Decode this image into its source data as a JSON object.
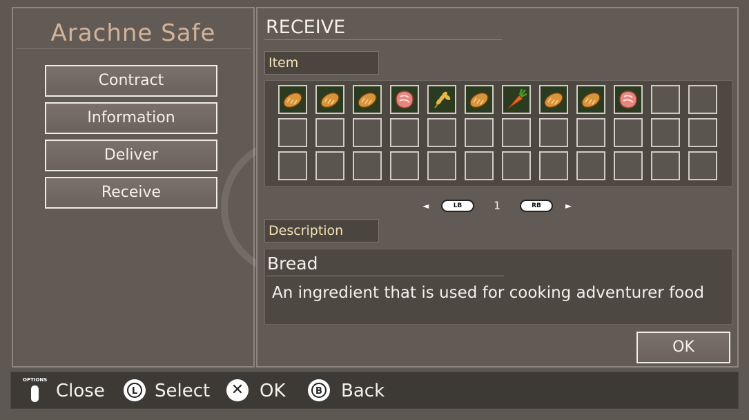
{
  "left_panel": {
    "title": "Arachne Safe",
    "menu": {
      "contract": "Contract",
      "information": "Information",
      "deliver": "Deliver",
      "receive": "Receive"
    }
  },
  "right_panel": {
    "title": "RECEIVE",
    "item_label": "Item",
    "grid": {
      "rows": 3,
      "cols": 12,
      "items": [
        "bread",
        "bread",
        "bread",
        "raw-meat",
        "wheat",
        "bread",
        "carrot",
        "bread",
        "bread",
        "raw-meat"
      ]
    },
    "pager": {
      "prev_arrow": "◄",
      "prev_button": "LB",
      "page": "1",
      "next_button": "RB",
      "next_arrow": "►"
    },
    "description_label": "Description",
    "description": {
      "name": "Bread",
      "text": "An ingredient that is used for cooking adventurer food"
    },
    "ok_label": "OK"
  },
  "bottom_bar": {
    "options_label": "OPTIONS",
    "close": "Close",
    "select_button": "L",
    "select": "Select",
    "ok_button": "✕",
    "ok": "OK",
    "back_button": "B",
    "back": "Back"
  },
  "colors": {
    "background": "#5e5853",
    "panel": "#625b55",
    "label_text": "#f3e2b2",
    "title_text": "#d2b39a",
    "bread": "#d9943a",
    "meat": "#e5867f",
    "carrot": "#e76a1c"
  }
}
